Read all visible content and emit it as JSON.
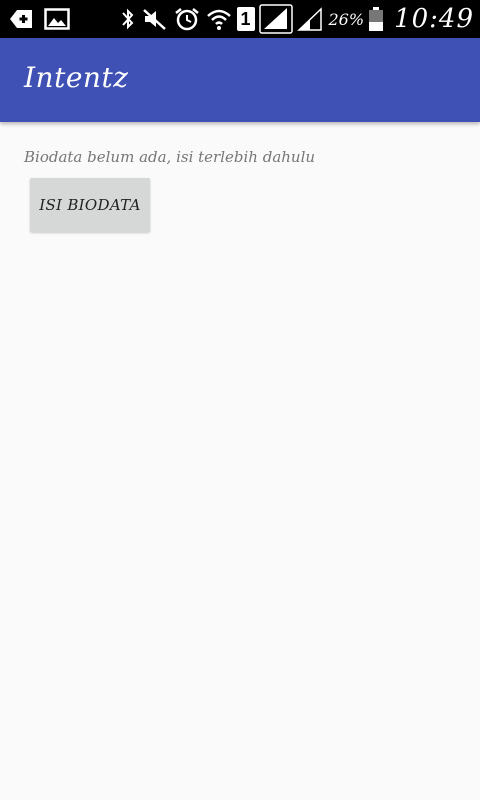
{
  "status_bar": {
    "icons_left": [
      "add-icon",
      "image-icon"
    ],
    "icons_right": [
      "bluetooth-icon",
      "mute-icon",
      "alarm-icon",
      "wifi-icon",
      "sim-icon",
      "signal-icon",
      "signal-2-icon",
      "battery-icon"
    ],
    "sim_label": "1",
    "battery_percent": "26%",
    "time": "10:49"
  },
  "app_bar": {
    "title": "Intentz",
    "color": "#3f51b5"
  },
  "content": {
    "message": "Biodata belum ada, isi terlebih dahulu",
    "button_label": "ISI BIODATA"
  }
}
